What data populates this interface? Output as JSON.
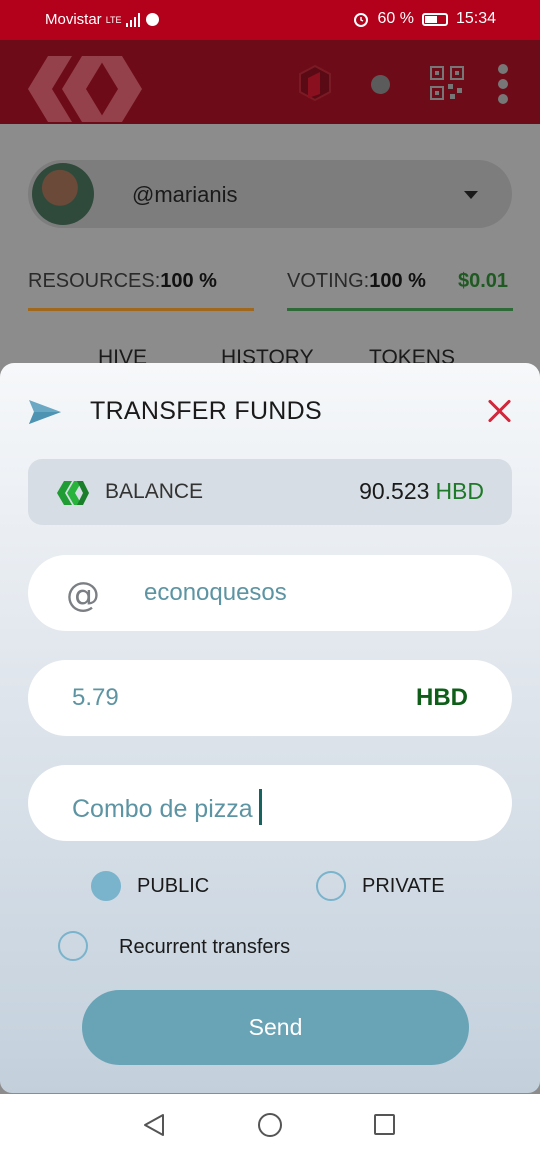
{
  "status_bar": {
    "carrier": "Movistar",
    "network": "LTE",
    "battery": "60 %",
    "time": "15:34"
  },
  "colors": {
    "brand_red": "#b3001b",
    "accent_teal": "#69a3b6",
    "hbd_green": "#1e7a28",
    "close_red": "#d3263b"
  },
  "background": {
    "account": "@marianis",
    "resources_label": "RESOURCES:",
    "resources_value": "100 %",
    "voting_label": "VOTING:",
    "voting_value": "100 %",
    "vote_value": "$0.01",
    "tabs": [
      "HIVE",
      "HISTORY",
      "TOKENS"
    ]
  },
  "modal": {
    "title": "TRANSFER FUNDS",
    "icons": {
      "title": "send-icon",
      "close": "close-icon",
      "balance": "hive-icon",
      "recipient": "at-icon"
    },
    "balance_label": "BALANCE",
    "balance_amount": "90.523",
    "balance_currency": "HBD",
    "recipient": "econoquesos",
    "amount": "5.79",
    "amount_currency": "HBD",
    "memo": "Combo de pizza",
    "public_label": "PUBLIC",
    "public_selected": true,
    "private_label": "PRIVATE",
    "private_selected": false,
    "recurrent_label": "Recurrent transfers",
    "recurrent_selected": false,
    "send_label": "Send"
  },
  "nav": {
    "back": "back-icon",
    "home": "home-icon",
    "recents": "recents-icon"
  }
}
